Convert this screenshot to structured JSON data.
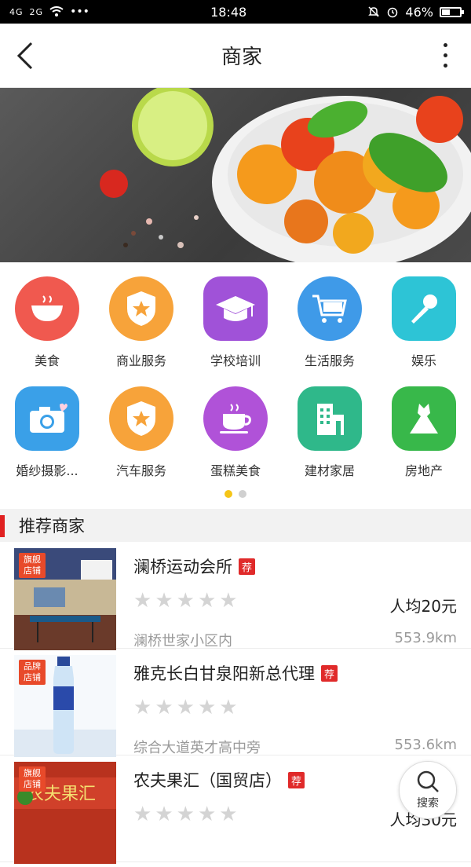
{
  "status": {
    "signal1": "4G",
    "signal2": "2G",
    "time": "18:48",
    "battery": "46%",
    "battery_level": 0.46
  },
  "nav": {
    "title": "商家"
  },
  "categories": [
    [
      {
        "label": "美食",
        "icon": "rice-bowl-icon",
        "color": "#f0594f"
      },
      {
        "label": "商业服务",
        "icon": "shield-star-icon",
        "color": "#f7a33a"
      },
      {
        "label": "学校培训",
        "icon": "graduation-cap-icon",
        "color": "#a052d8"
      },
      {
        "label": "生活服务",
        "icon": "shopping-cart-icon",
        "color": "#3f9ae8"
      },
      {
        "label": "娱乐",
        "icon": "microphone-icon",
        "color": "#2dc4d6"
      }
    ],
    [
      {
        "label": "婚纱摄影...",
        "icon": "camera-icon",
        "color": "#3aa0e8"
      },
      {
        "label": "汽车服务",
        "icon": "shield-star-icon",
        "color": "#f7a33a"
      },
      {
        "label": "蛋糕美食",
        "icon": "coffee-cup-icon",
        "color": "#b052d8"
      },
      {
        "label": "建材家居",
        "icon": "building-icon",
        "color": "#2fb88a"
      },
      {
        "label": "房地产",
        "icon": "dress-icon",
        "color": "#38b84a"
      }
    ]
  ],
  "section": {
    "title": "推荐商家"
  },
  "shops": [
    {
      "badge": "旗舰店铺",
      "name": "澜桥运动会所",
      "tag": "荐",
      "rating": 0,
      "price": "人均20元",
      "address": "澜桥世家小区内",
      "distance": "553.9km"
    },
    {
      "badge": "品牌店铺",
      "name": "雅克长白甘泉阳新总代理",
      "tag": "荐",
      "rating": 0,
      "price": "",
      "address": "综合大道英才高中旁",
      "distance": "553.6km"
    },
    {
      "badge": "旗舰店铺",
      "name": "农夫果汇（国贸店）",
      "tag": "荐",
      "rating": 0,
      "price": "人均30元",
      "address": "",
      "distance": ""
    }
  ],
  "fab": {
    "label": "搜索"
  }
}
